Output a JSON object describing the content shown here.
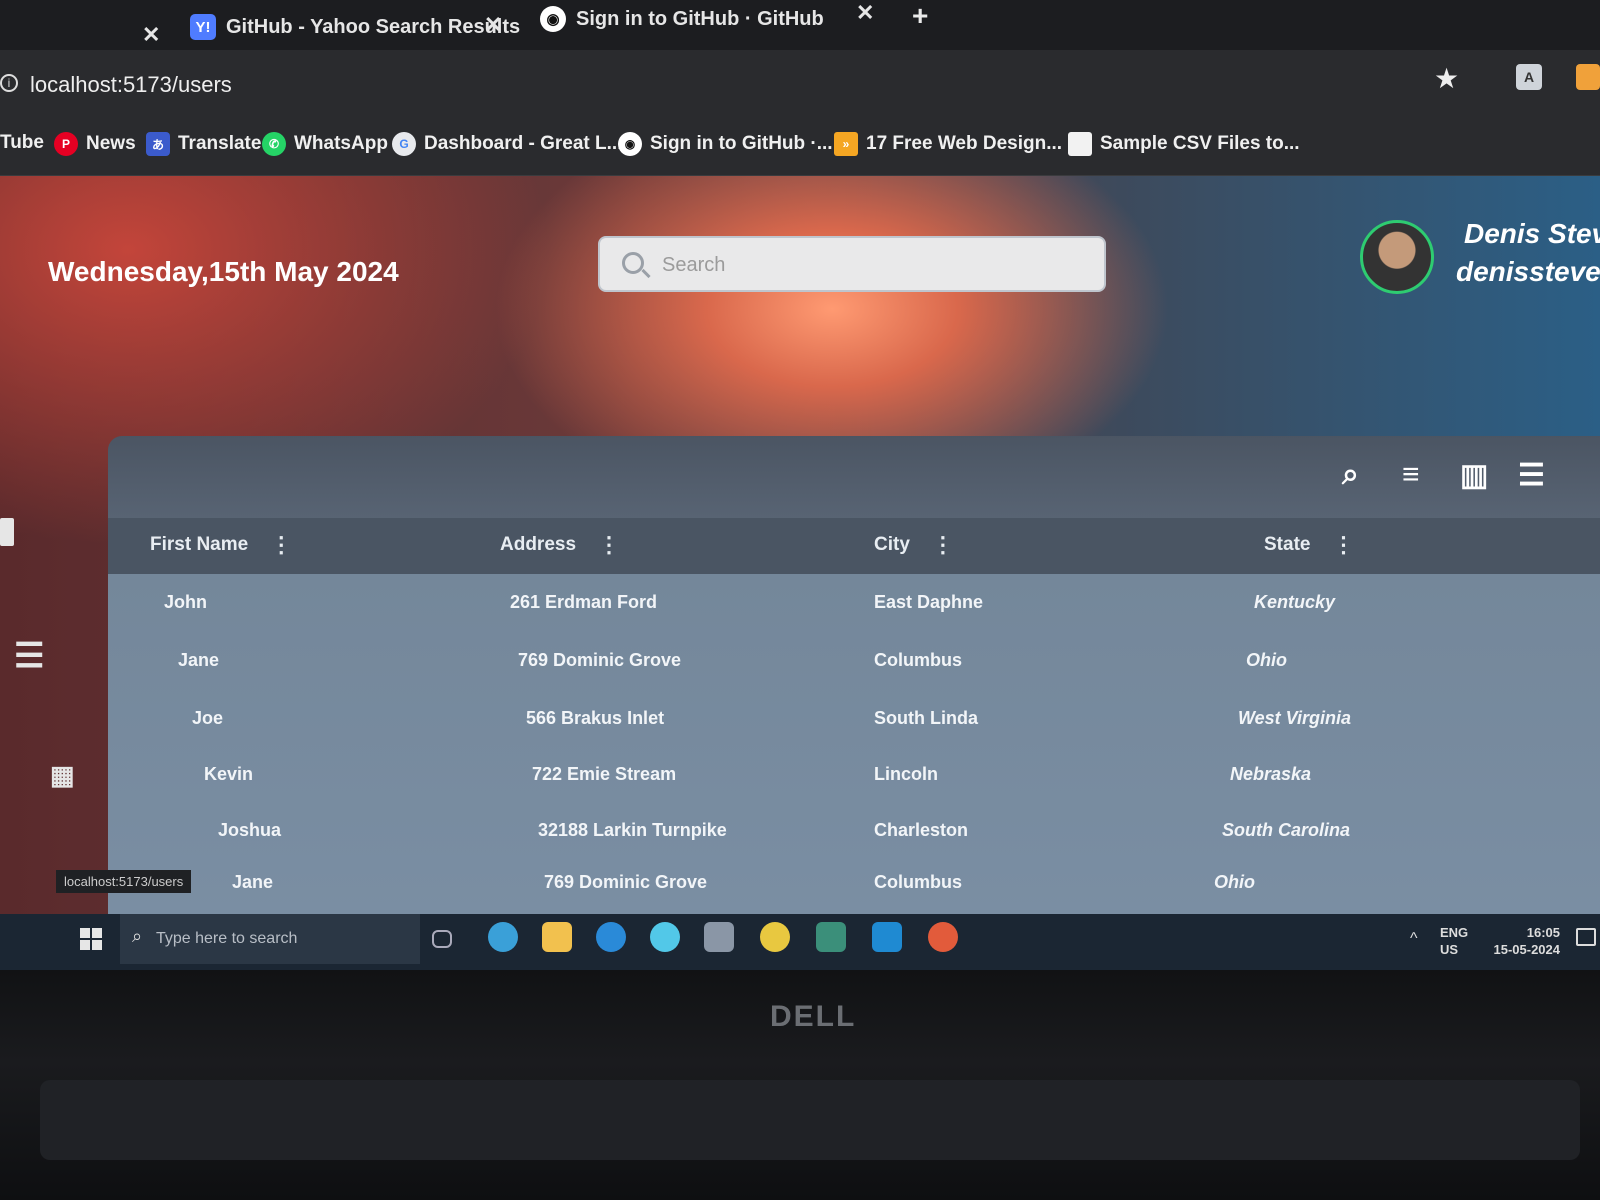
{
  "browser": {
    "tabs": [
      {
        "title": "GitHub - Yahoo Search Results",
        "icon": "yahoo-icon",
        "color": "#4f7cff"
      },
      {
        "title": "Sign in to GitHub · GitHub",
        "icon": "github-icon",
        "color": "#ffffff"
      }
    ],
    "url": "localhost:5173/users",
    "bookmarks": [
      {
        "label": "Tube",
        "icon": "youtube-icon"
      },
      {
        "label": "News",
        "icon": "pinterest-icon"
      },
      {
        "label": "Translate",
        "icon": "translate-icon"
      },
      {
        "label": "WhatsApp",
        "icon": "whatsapp-icon"
      },
      {
        "label": "Dashboard - Great L...",
        "icon": "google-icon"
      },
      {
        "label": "Sign in to GitHub ·...",
        "icon": "github-icon"
      },
      {
        "label": "17 Free Web Design...",
        "icon": "design-icon"
      },
      {
        "label": "Sample CSV Files to...",
        "icon": "file-icon"
      }
    ]
  },
  "header": {
    "date": "Wednesday,15th May 2024",
    "search_placeholder": "Search",
    "user_name": "Denis Steve",
    "user_handle": "denissteven"
  },
  "table": {
    "columns": [
      "First Name",
      "Address",
      "City",
      "State"
    ],
    "rows": [
      {
        "first_name": "John",
        "address": "261 Erdman Ford",
        "city": "East Daphne",
        "state": "Kentucky"
      },
      {
        "first_name": "Jane",
        "address": "769 Dominic Grove",
        "city": "Columbus",
        "state": "Ohio"
      },
      {
        "first_name": "Joe",
        "address": "566 Brakus Inlet",
        "city": "South Linda",
        "state": "West Virginia"
      },
      {
        "first_name": "Kevin",
        "address": "722 Emie Stream",
        "city": "Lincoln",
        "state": "Nebraska"
      },
      {
        "first_name": "Joshua",
        "address": "32188 Larkin Turnpike",
        "city": "Charleston",
        "state": "South Carolina"
      },
      {
        "first_name": "Jane",
        "address": "769 Dominic Grove",
        "city": "Columbus",
        "state": "Ohio"
      }
    ]
  },
  "status_url": "localhost:5173/users",
  "taskbar": {
    "search_placeholder": "Type here to search",
    "lang": "ENG",
    "region": "US",
    "time": "16:05",
    "date": "15-05-2024"
  },
  "brand": "DELL"
}
